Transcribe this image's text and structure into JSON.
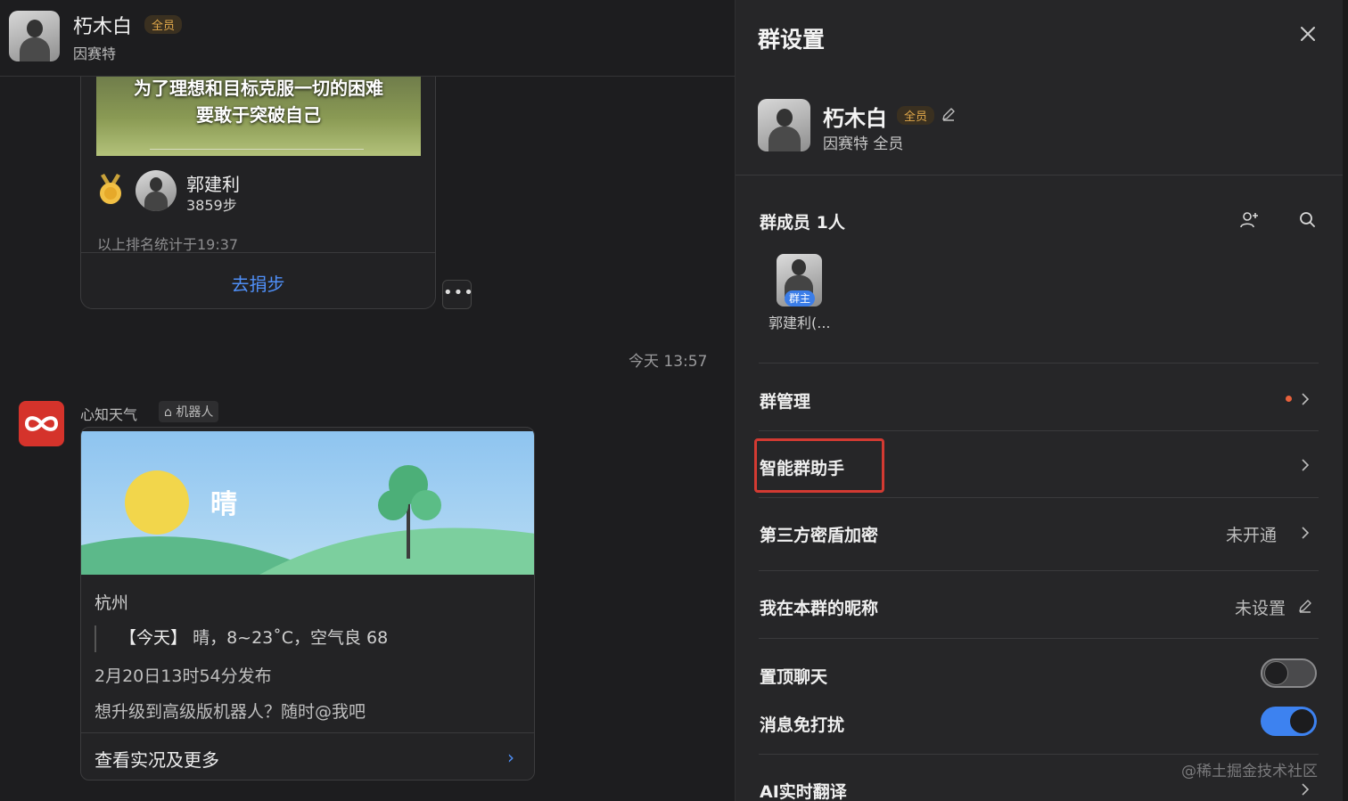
{
  "chat_header": {
    "name": "朽木白",
    "badge": "全员",
    "subtitle": "因赛特"
  },
  "rank_card": {
    "banner_line1": "为了理想和目标克服一切的困难",
    "banner_line2": "要敢于突破自己",
    "user_name": "郭建利",
    "steps": "3859步",
    "note": "以上排名统计于19:37",
    "action": "去捐步"
  },
  "timestamp": "今天 13:57",
  "bot": {
    "name": "心知天气",
    "tag": "机器人"
  },
  "weather_card": {
    "condition": "晴",
    "city": "杭州",
    "today_label": "【今天】",
    "today_value": "晴，8~23˚C，空气良 68",
    "published": "2月20日13时54分发布",
    "tip": "想升级到高级版机器人？随时@我吧",
    "more": "查看实况及更多"
  },
  "settings": {
    "title": "群设置",
    "group_name": "朽木白",
    "group_badge": "全员",
    "group_sub": "因赛特  全员",
    "members_title": "群成员 1人",
    "member_name": "郭建利(...",
    "owner_tag": "群主",
    "rows": {
      "manage": "群管理",
      "assistant": "智能群助手",
      "encryption": "第三方密盾加密",
      "encryption_value": "未开通",
      "nickname": "我在本群的昵称",
      "nickname_value": "未设置",
      "pin": "置顶聊天",
      "mute": "消息免打扰",
      "translate": "AI实时翻译"
    },
    "toggles": {
      "pin_on": false,
      "mute_on": true
    }
  },
  "watermark": "@稀土掘金技术社区",
  "colors": {
    "accent_blue": "#3d82f0",
    "link_blue": "#4f8ff7",
    "highlight_red": "#d33a32",
    "badge_gold": "#e0a84a"
  }
}
